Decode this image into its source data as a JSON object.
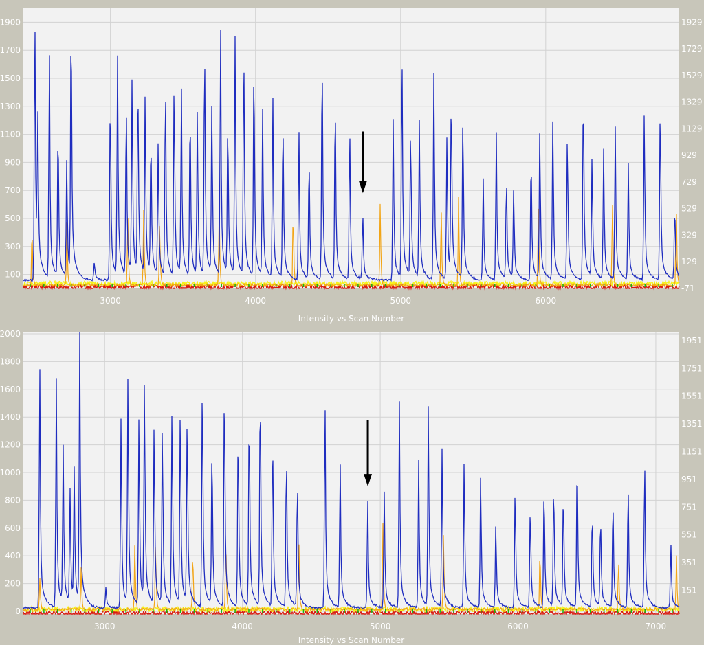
{
  "colors": {
    "background": "#c8c6ba",
    "plot_background": "#f2f2f2",
    "grid": "#d2d2d2",
    "axis_text": "#ffffff",
    "trace_blue": "#1f2dbf",
    "trace_orange": "#f2a516",
    "trace_yellow": "#f6f218",
    "trace_red": "#d81a10",
    "trace_green": "#16b816",
    "arrow": "#000000"
  },
  "chart_data": [
    {
      "type": "line",
      "xlabel": "Intensity vs Scan Number",
      "xlim": [
        2400,
        6920
      ],
      "x_ticks": [
        "3000",
        "4000",
        "5000",
        "6000"
      ],
      "x_tick_values": [
        3000,
        4000,
        5000,
        6000
      ],
      "ylim_left": [
        0,
        2000
      ],
      "y_ticks_left": [
        "100",
        "300",
        "500",
        "700",
        "900",
        "1100",
        "1300",
        "1500",
        "1700",
        "1900"
      ],
      "y_tick_values_left": [
        100,
        300,
        500,
        700,
        900,
        1100,
        1300,
        1500,
        1700,
        1900
      ],
      "y_ticks_right": [
        "-71",
        "129",
        "329",
        "529",
        "729",
        "929",
        "1129",
        "1329",
        "1529",
        "1729",
        "1929"
      ],
      "grid": true,
      "annotation": {
        "type": "arrow",
        "x": 4740,
        "y_from": 1120,
        "y_to": 700
      },
      "series": [
        {
          "color": "blue",
          "baseline": 60,
          "peaks": [
            {
              "x": 2480,
              "y": 1980
            },
            {
              "x": 2500,
              "y": 1050
            },
            {
              "x": 2580,
              "y": 1600
            },
            {
              "x": 2640,
              "y": 1150
            },
            {
              "x": 2700,
              "y": 880
            },
            {
              "x": 2730,
              "y": 2000
            },
            {
              "x": 2890,
              "y": 140
            },
            {
              "x": 3000,
              "y": 1440
            },
            {
              "x": 3050,
              "y": 1600
            },
            {
              "x": 3110,
              "y": 1300
            },
            {
              "x": 3150,
              "y": 1450
            },
            {
              "x": 3190,
              "y": 1480
            },
            {
              "x": 3240,
              "y": 1330
            },
            {
              "x": 3280,
              "y": 1050
            },
            {
              "x": 3330,
              "y": 990
            },
            {
              "x": 3380,
              "y": 1450
            },
            {
              "x": 3440,
              "y": 1500
            },
            {
              "x": 3490,
              "y": 1320
            },
            {
              "x": 3550,
              "y": 1290
            },
            {
              "x": 3600,
              "y": 1220
            },
            {
              "x": 3650,
              "y": 1730
            },
            {
              "x": 3700,
              "y": 1300
            },
            {
              "x": 3760,
              "y": 1760
            },
            {
              "x": 3810,
              "y": 1190
            },
            {
              "x": 3860,
              "y": 1720
            },
            {
              "x": 3920,
              "y": 1720
            },
            {
              "x": 3990,
              "y": 1680
            },
            {
              "x": 4050,
              "y": 1240
            },
            {
              "x": 4120,
              "y": 1280
            },
            {
              "x": 4190,
              "y": 1200
            },
            {
              "x": 4300,
              "y": 1050
            },
            {
              "x": 4370,
              "y": 920
            },
            {
              "x": 4460,
              "y": 1710
            },
            {
              "x": 4550,
              "y": 1360
            },
            {
              "x": 4650,
              "y": 1120
            },
            {
              "x": 4740,
              "y": 480
            },
            {
              "x": 4950,
              "y": 1180
            },
            {
              "x": 5010,
              "y": 1680
            },
            {
              "x": 5070,
              "y": 1140
            },
            {
              "x": 5130,
              "y": 1140
            },
            {
              "x": 5230,
              "y": 1560
            },
            {
              "x": 5320,
              "y": 1060
            },
            {
              "x": 5350,
              "y": 1380
            },
            {
              "x": 5430,
              "y": 1270
            },
            {
              "x": 5570,
              "y": 720
            },
            {
              "x": 5660,
              "y": 1050
            },
            {
              "x": 5730,
              "y": 760
            },
            {
              "x": 5780,
              "y": 670
            },
            {
              "x": 5900,
              "y": 960
            },
            {
              "x": 5960,
              "y": 1120
            },
            {
              "x": 6050,
              "y": 1230
            },
            {
              "x": 6150,
              "y": 1110
            },
            {
              "x": 6260,
              "y": 1490
            },
            {
              "x": 6320,
              "y": 900
            },
            {
              "x": 6400,
              "y": 960
            },
            {
              "x": 6480,
              "y": 1100
            },
            {
              "x": 6570,
              "y": 840
            },
            {
              "x": 6680,
              "y": 1260
            },
            {
              "x": 6790,
              "y": 1350
            },
            {
              "x": 6890,
              "y": 580
            }
          ]
        },
        {
          "color": "orange",
          "baseline": 25,
          "peaks": [
            {
              "x": 2460,
              "y": 450
            },
            {
              "x": 2700,
              "y": 500
            },
            {
              "x": 3120,
              "y": 500
            },
            {
              "x": 3230,
              "y": 550
            },
            {
              "x": 3340,
              "y": 490
            },
            {
              "x": 3750,
              "y": 580
            },
            {
              "x": 4260,
              "y": 590
            },
            {
              "x": 4860,
              "y": 610
            },
            {
              "x": 5280,
              "y": 600
            },
            {
              "x": 5400,
              "y": 640
            },
            {
              "x": 5950,
              "y": 580
            },
            {
              "x": 6460,
              "y": 630
            },
            {
              "x": 6900,
              "y": 650
            }
          ]
        }
      ]
    },
    {
      "type": "line",
      "xlabel": "Intensity vs Scan Number",
      "xlim": [
        2410,
        7170
      ],
      "x_ticks": [
        "3000",
        "4000",
        "5000",
        "6000",
        "7000"
      ],
      "x_tick_values": [
        3000,
        4000,
        5000,
        6000,
        7000
      ],
      "ylim_left": [
        -20,
        2010
      ],
      "y_ticks_left": [
        "0",
        "200",
        "400",
        "600",
        "800",
        "1000",
        "1200",
        "1400",
        "1600",
        "1800",
        "2000"
      ],
      "y_tick_values_left": [
        0,
        200,
        400,
        600,
        800,
        1000,
        1200,
        1400,
        1600,
        1800,
        2000
      ],
      "y_ticks_right": [
        "151",
        "351",
        "551",
        "751",
        "951",
        "1151",
        "1351",
        "1551",
        "1751",
        "1951"
      ],
      "grid": true,
      "annotation": {
        "type": "arrow",
        "x": 4910,
        "y_from": 1380,
        "y_to": 920
      },
      "series": [
        {
          "color": "blue",
          "baseline": 25,
          "peaks": [
            {
              "x": 2530,
              "y": 1720
            },
            {
              "x": 2650,
              "y": 1650
            },
            {
              "x": 2700,
              "y": 1140
            },
            {
              "x": 2750,
              "y": 840
            },
            {
              "x": 2780,
              "y": 970
            },
            {
              "x": 2820,
              "y": 1980
            },
            {
              "x": 3010,
              "y": 150
            },
            {
              "x": 3120,
              "y": 1440
            },
            {
              "x": 3170,
              "y": 1710
            },
            {
              "x": 3250,
              "y": 1450
            },
            {
              "x": 3290,
              "y": 1670
            },
            {
              "x": 3360,
              "y": 1380
            },
            {
              "x": 3420,
              "y": 1360
            },
            {
              "x": 3490,
              "y": 1540
            },
            {
              "x": 3550,
              "y": 1520
            },
            {
              "x": 3600,
              "y": 1440
            },
            {
              "x": 3710,
              "y": 1760
            },
            {
              "x": 3780,
              "y": 1250
            },
            {
              "x": 3870,
              "y": 1750
            },
            {
              "x": 3970,
              "y": 1400
            },
            {
              "x": 4050,
              "y": 1540
            },
            {
              "x": 4130,
              "y": 1720
            },
            {
              "x": 4220,
              "y": 1320
            },
            {
              "x": 4320,
              "y": 1180
            },
            {
              "x": 4400,
              "y": 960
            },
            {
              "x": 4600,
              "y": 1540
            },
            {
              "x": 4710,
              "y": 1060
            },
            {
              "x": 4910,
              "y": 780
            },
            {
              "x": 5030,
              "y": 840
            },
            {
              "x": 5140,
              "y": 1500
            },
            {
              "x": 5280,
              "y": 1100
            },
            {
              "x": 5350,
              "y": 1490
            },
            {
              "x": 5450,
              "y": 1200
            },
            {
              "x": 5610,
              "y": 1110
            },
            {
              "x": 5730,
              "y": 1030
            },
            {
              "x": 5840,
              "y": 650
            },
            {
              "x": 5980,
              "y": 920
            },
            {
              "x": 6090,
              "y": 780
            },
            {
              "x": 6190,
              "y": 940
            },
            {
              "x": 6260,
              "y": 970
            },
            {
              "x": 6330,
              "y": 900
            },
            {
              "x": 6430,
              "y": 1170
            },
            {
              "x": 6540,
              "y": 760
            },
            {
              "x": 6600,
              "y": 700
            },
            {
              "x": 6690,
              "y": 820
            },
            {
              "x": 6800,
              "y": 940
            },
            {
              "x": 6920,
              "y": 1100
            },
            {
              "x": 7110,
              "y": 470
            }
          ]
        },
        {
          "color": "orange",
          "baseline": 15,
          "peaks": [
            {
              "x": 2530,
              "y": 230
            },
            {
              "x": 2830,
              "y": 320
            },
            {
              "x": 3220,
              "y": 520
            },
            {
              "x": 3370,
              "y": 540
            },
            {
              "x": 3640,
              "y": 460
            },
            {
              "x": 3880,
              "y": 580
            },
            {
              "x": 4410,
              "y": 560
            },
            {
              "x": 5020,
              "y": 620
            },
            {
              "x": 5460,
              "y": 580
            },
            {
              "x": 6160,
              "y": 480
            },
            {
              "x": 6730,
              "y": 380
            },
            {
              "x": 7150,
              "y": 400
            }
          ]
        }
      ]
    }
  ]
}
